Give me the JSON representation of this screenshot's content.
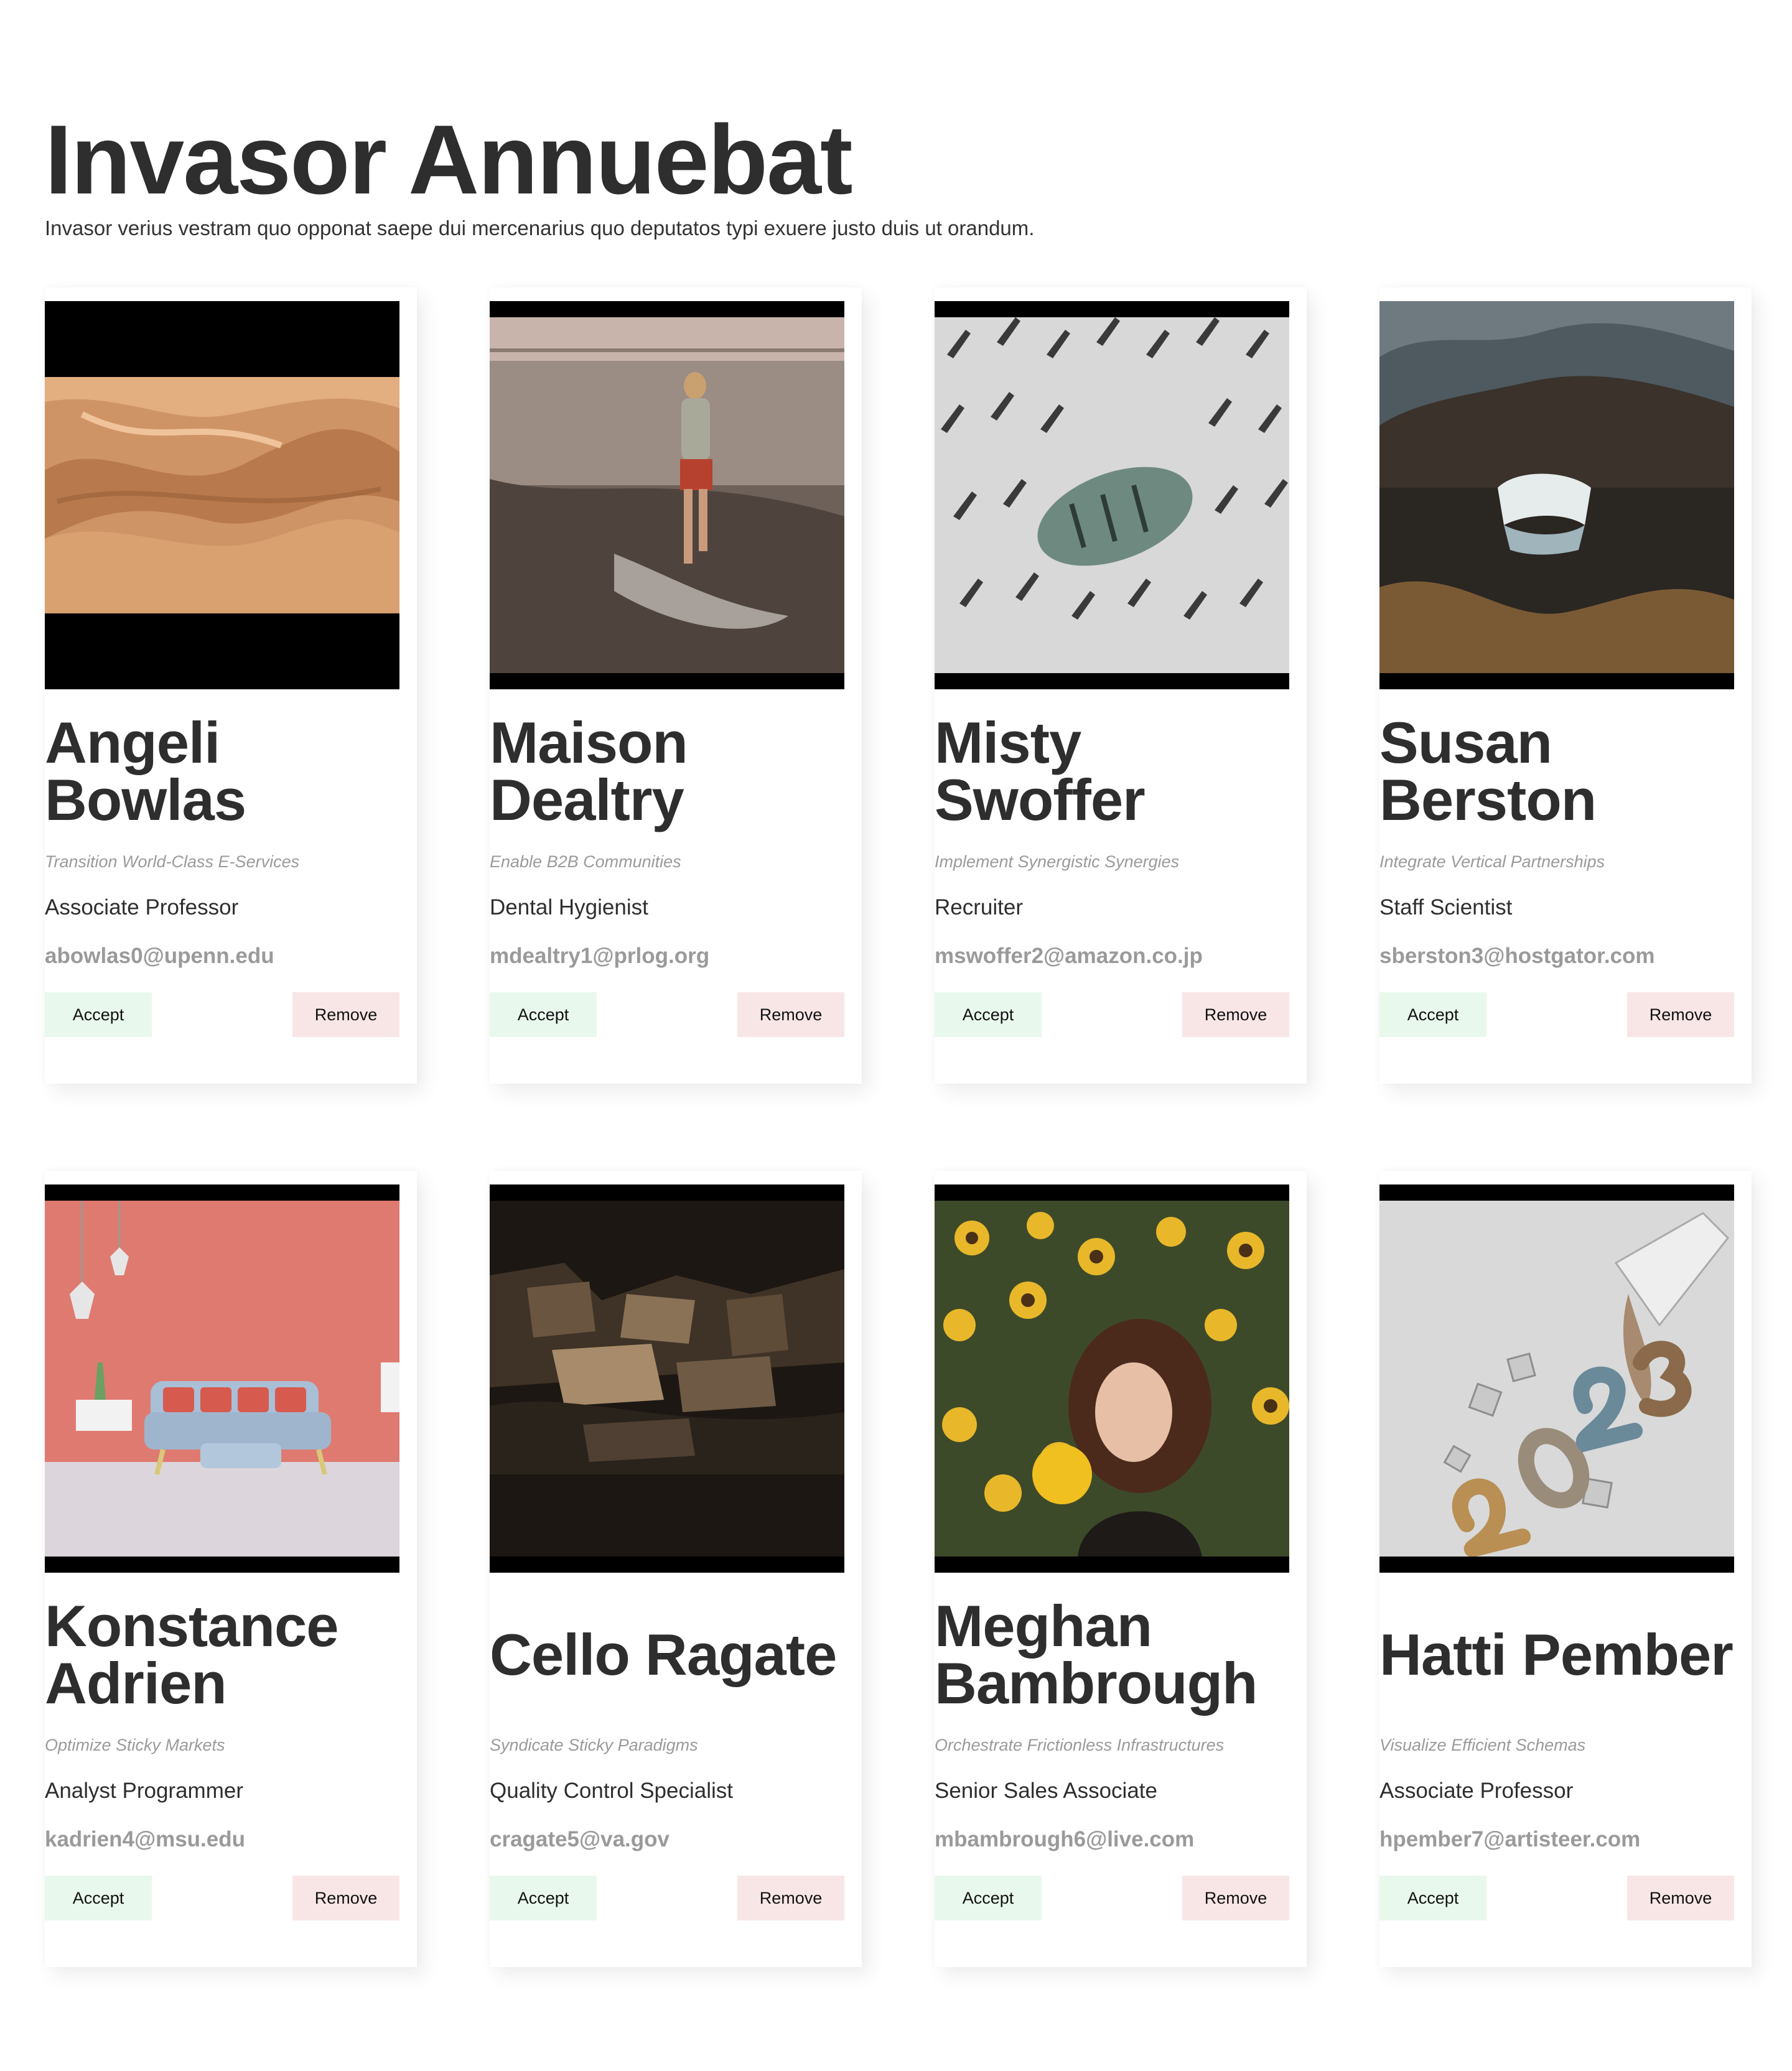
{
  "header": {
    "title": "Invasor Annuebat",
    "subtitle": "Invasor verius vestram quo opponat saepe dui mercenarius quo deputatos typi exuere justo duis ut orandum."
  },
  "accept_label": "Accept",
  "remove_label": "Remove",
  "cards": [
    {
      "name": "Angeli Bowlas",
      "tagline": "Transition World-Class E-Services",
      "job": "Associate Professor",
      "email": "abowlas0@upenn.edu",
      "image": "desert-dunes"
    },
    {
      "name": "Maison Dealtry",
      "tagline": "Enable B2B Communities",
      "job": "Dental Hygienist",
      "email": "mdealtry1@prlog.org",
      "image": "woman-walking-beach"
    },
    {
      "name": "Misty Swoffer",
      "tagline": "Implement Synergistic Synergies",
      "job": "Recruiter",
      "email": "mswoffer2@amazon.co.jp",
      "image": "architecture-facade"
    },
    {
      "name": "Susan Berston",
      "tagline": "Integrate Vertical Partnerships",
      "job": "Staff Scientist",
      "email": "sberston3@hostgator.com",
      "image": "waterfall-landscape"
    },
    {
      "name": "Konstance Adrien",
      "tagline": "Optimize Sticky Markets",
      "job": "Analyst Programmer",
      "email": "kadrien4@msu.edu",
      "image": "living-room-sofa"
    },
    {
      "name": "Cello Ragate",
      "tagline": "Syndicate Sticky Paradigms",
      "job": "Quality Control Specialist",
      "email": "cragate5@va.gov",
      "image": "abstract-brown-blocks"
    },
    {
      "name": "Meghan Bambrough",
      "tagline": "Orchestrate Frictionless Infrastructures",
      "job": "Senior Sales Associate",
      "email": "mbambrough6@live.com",
      "image": "woman-sunflowers"
    },
    {
      "name": "Hatti Pember",
      "tagline": "Visualize Efficient Schemas",
      "job": "Associate Professor",
      "email": "hpember7@artisteer.com",
      "image": "glitter-2023-numbers"
    }
  ]
}
